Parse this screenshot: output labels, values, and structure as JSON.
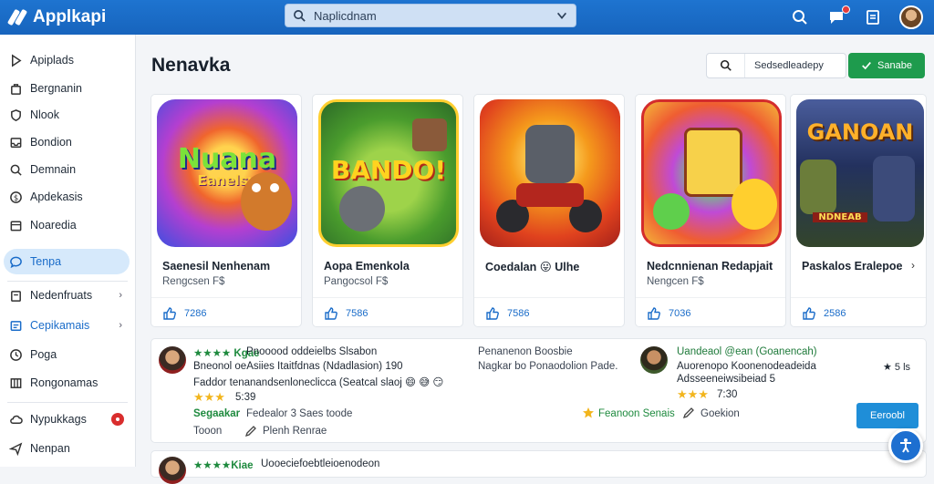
{
  "app": {
    "name": "Applkapi"
  },
  "topbar": {
    "search_placeholder": "Naplicdnam"
  },
  "sidebar": {
    "items": [
      {
        "label": "Apiplads",
        "icon": "play-outline-icon"
      },
      {
        "label": "Bergnanin",
        "icon": "bag-icon"
      },
      {
        "label": "Nlook",
        "icon": "shield-icon"
      },
      {
        "label": "Bondion",
        "icon": "inbox-icon"
      },
      {
        "label": "Demnain",
        "icon": "search-icon"
      },
      {
        "label": "Apdekasis",
        "icon": "dollar-circle-icon"
      },
      {
        "label": "Noaredia",
        "icon": "calendar-icon"
      },
      {
        "label": "Tenpa",
        "icon": "chat-icon",
        "active": true
      },
      {
        "label": "Nedenfruats",
        "icon": "clipboard-icon",
        "chevron": "›"
      },
      {
        "label": "Cepikamais",
        "icon": "grid-icon",
        "chevron": "›"
      },
      {
        "label": "Poga",
        "icon": "clock-icon"
      },
      {
        "label": "Rongonamas",
        "icon": "columns-icon"
      },
      {
        "label": "Nypukkags",
        "icon": "cloud-icon",
        "badge": true
      },
      {
        "label": "Nenpan",
        "icon": "send-icon"
      }
    ]
  },
  "main": {
    "title": "Nenavka",
    "search_value": "Sedsedleadepy",
    "action_label": "Sanabe"
  },
  "games": [
    {
      "title": "Saenesil Nenhenam",
      "subtitle": "Rengcsen F$",
      "likes": "7286",
      "art_text": "Nuana",
      "art_text2": "Eanelsy"
    },
    {
      "title": "Aopa Emenkola",
      "subtitle": "Pangocsol F$",
      "likes": "7586",
      "art_text": "BANDO!"
    },
    {
      "title": "Coedalan 😛 Ulhe",
      "subtitle": "",
      "likes": "7586",
      "art_text": ""
    },
    {
      "title": "Nedcnnienan Redapjait",
      "subtitle": "Nengcen F$",
      "likes": "7036",
      "art_text": ""
    },
    {
      "title": "Paskalos Eralepoe",
      "subtitle": "",
      "likes": "2586",
      "art_text": "GANOAN",
      "art_text2": "NDNEAB",
      "more": "›"
    }
  ],
  "reviews": [
    {
      "name_line": "★★★★ Kgae",
      "text_line1": "Pnooood oddeielbs Slsabon",
      "text_line2": "Bneonol oeAsiies Itaitfdnas (Ndadlasion) 190",
      "text_line3": "Faddor tenanandsenloneclicca (Seatcal slaoj 😄 😅 😏",
      "stars": "★★★",
      "rating": "5:39",
      "tag": "Segaakar",
      "tag_text": "Fedealor 3 Saes toode",
      "action1": "Tooon",
      "action2": "Plenh Renrae",
      "mid_line1": "Penanenon Boosbie",
      "mid_line2": "Nagkar bo Ponaodolion Pade.",
      "name2": "Uandeaol @ean (Goanencah)",
      "text2_line1": "Auorenopo Koonenodeadeida",
      "text2_line2": "Adsseeneiwsibeiad 5",
      "stars2": "★★★",
      "rating2": "7:30",
      "right_badge": "★ 5 ls",
      "tag2": "Feanoon Senais",
      "action3": "Goekion",
      "button": "Eeroobl"
    },
    {
      "name_line": "★★★★Kiae",
      "text_line1": "Uooeciefoebtleioenodeon"
    }
  ],
  "colors": {
    "brand": "#1a6cc9",
    "green": "#1e9b4d",
    "star": "#f2b51d",
    "badge": "#d92d2d"
  }
}
